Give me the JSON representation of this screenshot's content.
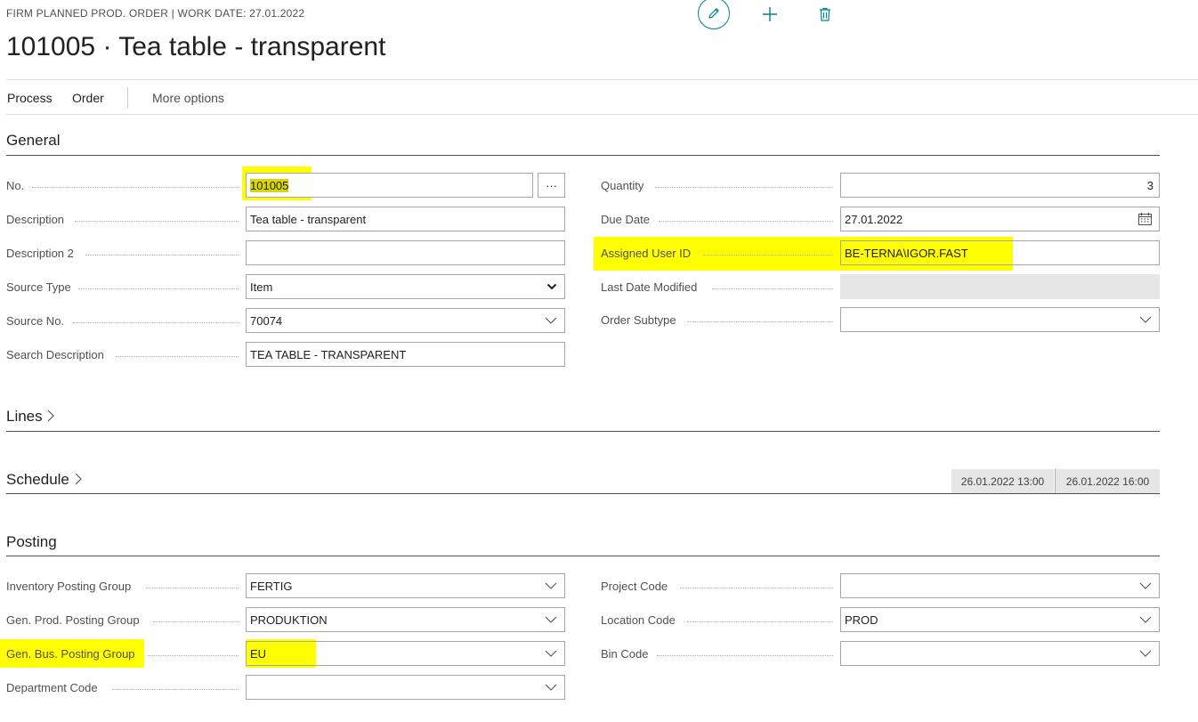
{
  "header": {
    "caption": "FIRM PLANNED PROD. ORDER | WORK DATE: 27.01.2022",
    "title": "101005 · Tea table - transparent"
  },
  "actions": {
    "icons": [
      "edit-icon",
      "add-icon",
      "delete-icon"
    ]
  },
  "menu": {
    "process": "Process",
    "order": "Order",
    "more": "More options"
  },
  "general": {
    "title": "General",
    "no": {
      "label": "No.",
      "value": "101005",
      "assist": "···"
    },
    "description": {
      "label": "Description",
      "value": "Tea table - transparent"
    },
    "description2": {
      "label": "Description 2",
      "value": ""
    },
    "source_type": {
      "label": "Source Type",
      "value": "Item"
    },
    "source_no": {
      "label": "Source No.",
      "value": "70074"
    },
    "search_description": {
      "label": "Search Description",
      "value": "TEA TABLE - TRANSPARENT"
    },
    "quantity": {
      "label": "Quantity",
      "value": "3"
    },
    "due_date": {
      "label": "Due Date",
      "value": "27.01.2022"
    },
    "assigned_user": {
      "label": "Assigned User ID",
      "value": "BE-TERNA\\IGOR.FAST"
    },
    "last_date_modified": {
      "label": "Last Date Modified",
      "value": ""
    },
    "order_subtype": {
      "label": "Order Subtype",
      "value": ""
    }
  },
  "lines": {
    "title": "Lines"
  },
  "schedule": {
    "title": "Schedule",
    "start": "26.01.2022 13:00",
    "end": "26.01.2022 16:00"
  },
  "posting": {
    "title": "Posting",
    "inventory_posting_group": {
      "label": "Inventory Posting Group",
      "value": "FERTIG"
    },
    "gen_prod_posting_group": {
      "label": "Gen. Prod. Posting Group",
      "value": "PRODUKTION"
    },
    "gen_bus_posting_group": {
      "label": "Gen. Bus. Posting Group",
      "value": "EU"
    },
    "department_code": {
      "label": "Department Code",
      "value": ""
    },
    "project_code": {
      "label": "Project Code",
      "value": ""
    },
    "location_code": {
      "label": "Location Code",
      "value": "PROD"
    },
    "bin_code": {
      "label": "Bin Code",
      "value": ""
    }
  },
  "colors": {
    "accent": "#00838a",
    "highlight": "#ffff00"
  }
}
